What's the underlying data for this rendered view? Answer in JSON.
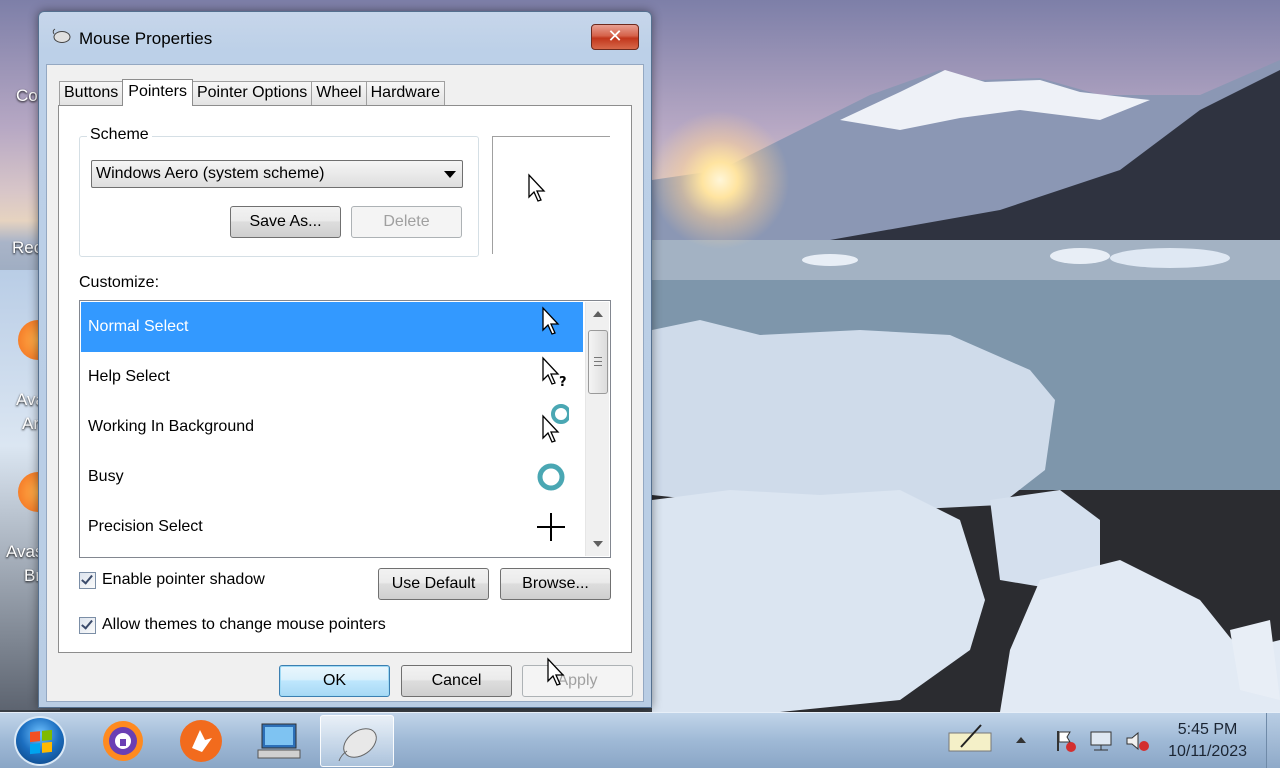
{
  "window": {
    "title": "Mouse Properties",
    "close_glyph": "✕"
  },
  "tabs": [
    {
      "label": "Buttons",
      "active": false
    },
    {
      "label": "Pointers",
      "active": true
    },
    {
      "label": "Pointer Options",
      "active": false
    },
    {
      "label": "Wheel",
      "active": false
    },
    {
      "label": "Hardware",
      "active": false
    }
  ],
  "scheme": {
    "group_label": "Scheme",
    "selected": "Windows Aero (system scheme)",
    "save_as_label": "Save As...",
    "delete_label": "Delete"
  },
  "customize": {
    "label": "Customize:",
    "items": [
      {
        "label": "Normal Select",
        "icon": "arrow-cursor-icon",
        "selected": true
      },
      {
        "label": "Help Select",
        "icon": "help-cursor-icon",
        "selected": false
      },
      {
        "label": "Working In Background",
        "icon": "working-cursor-icon",
        "selected": false
      },
      {
        "label": "Busy",
        "icon": "busy-cursor-icon",
        "selected": false
      },
      {
        "label": "Precision Select",
        "icon": "crosshair-cursor-icon",
        "selected": false
      }
    ]
  },
  "options": {
    "pointer_shadow_label": "Enable pointer shadow",
    "pointer_shadow_checked": true,
    "themes_label": "Allow themes to change mouse pointers",
    "themes_checked": true,
    "use_default_label": "Use Default",
    "browse_label": "Browse..."
  },
  "footer": {
    "ok_label": "OK",
    "cancel_label": "Cancel",
    "apply_label": "Apply"
  },
  "desktop": {
    "labels": [
      "Co",
      "Rec",
      "Ava",
      "Ar",
      "Avas",
      "Br"
    ]
  },
  "taskbar": {
    "time": "5:45 PM",
    "date": "10/11/2023",
    "apps": [
      "browser-icon",
      "avast-icon",
      "remote-desktop-icon",
      "mouse-icon"
    ]
  },
  "colors": {
    "selection": "#3399ff",
    "close_button": "#c1361c"
  }
}
